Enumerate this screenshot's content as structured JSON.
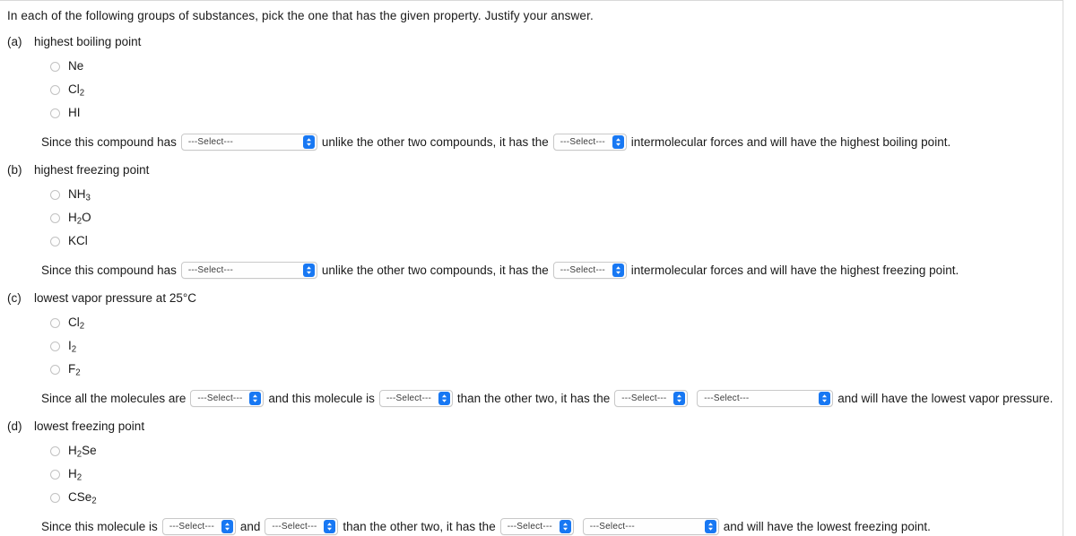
{
  "prompt": "In each of the following groups of substances, pick the one that has the given property. Justify your answer.",
  "select_placeholder": "---Select---",
  "accent_color": "#1878f3",
  "parts": [
    {
      "letter": "(a)",
      "title": "highest boiling point",
      "options": [
        "Ne",
        "Cl2",
        "HI"
      ],
      "sentence": {
        "seg1": "Since this compound has",
        "seg2": "unlike the other two compounds, it has the",
        "seg3": "intermolecular forces and will have the highest boiling point."
      }
    },
    {
      "letter": "(b)",
      "title": "highest freezing point",
      "options": [
        "NH3",
        "H2O",
        "KCl"
      ],
      "sentence": {
        "seg1": "Since this compound has",
        "seg2": "unlike the other two compounds, it has the",
        "seg3": "intermolecular forces and will have the highest freezing point."
      }
    },
    {
      "letter": "(c)",
      "title": "lowest vapor pressure at 25°C",
      "options": [
        "Cl2",
        "I2",
        "F2"
      ],
      "sentence": {
        "seg1": "Since all the molecules are",
        "seg2": "and this molecule is",
        "seg3": "than the other two, it has the",
        "seg4": "and will have the lowest vapor pressure."
      }
    },
    {
      "letter": "(d)",
      "title": "lowest freezing point",
      "options": [
        "H2Se",
        "H2",
        "CSe2"
      ],
      "sentence": {
        "seg1": "Since this molecule is",
        "seg2": "and",
        "seg3": "than the other two, it has the",
        "seg4": "and will have the lowest freezing point."
      }
    }
  ]
}
